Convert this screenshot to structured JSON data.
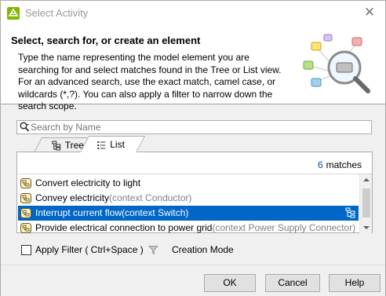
{
  "window": {
    "title": "Select Activity",
    "close_glyph": "✕"
  },
  "header": {
    "title": "Select, search for, or create an element",
    "description": "Type the name representing the model element you are searching for and select matches found in the Tree or List view. For an advanced search, use the exact match, camel case, or wildcards (*,?). You can also apply a filter to narrow down the search scope."
  },
  "search": {
    "placeholder": "Search by Name",
    "value": ""
  },
  "tabs": [
    {
      "label": "Tree",
      "icon": "tree-view-icon",
      "active": false
    },
    {
      "label": "List",
      "icon": "list-view-icon",
      "active": true
    }
  ],
  "results": {
    "count": "6",
    "count_suffix": "matches",
    "items": [
      {
        "name": "Convert electricity to light",
        "context": "",
        "selected": false,
        "icon": "activity-icon"
      },
      {
        "name": "Convey electricity",
        "context": "(context Conductor)",
        "selected": false,
        "icon": "activity-icon"
      },
      {
        "name": "Interrupt current flow",
        "context": "(context Switch)",
        "selected": true,
        "icon": "activity-icon"
      },
      {
        "name": "Provide electrical connection to power grid",
        "context": "(context Power Supply Connector)",
        "selected": false,
        "icon": "activity-icon"
      }
    ]
  },
  "filter": {
    "apply_label": "Apply Filter ( Ctrl+Space )",
    "checked": false,
    "creation_mode_label": "Creation Mode"
  },
  "buttons": {
    "ok": "OK",
    "cancel": "Cancel",
    "help": "Help"
  },
  "colors": {
    "selection": "#0067c7",
    "context_text": "#808080",
    "match_count": "#0b4fa8"
  }
}
